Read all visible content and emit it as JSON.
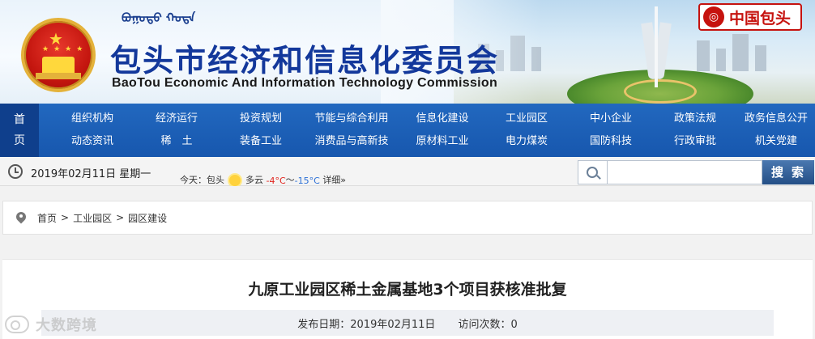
{
  "header": {
    "mongolian_text": "ᠪᠤᠭᠤᠲᠤ ᠬᠣᠲᠠ",
    "title_cn": "包头市经济和信息化委员会",
    "title_en": "BaoTou Economic And Information Technology Commission",
    "china_baotou_label": "中国包头",
    "emblem_star": "★"
  },
  "nav": {
    "home_top": "首",
    "home_bottom": "页",
    "columns": [
      {
        "top": "组织机构",
        "bottom": "动态资讯"
      },
      {
        "top": "经济运行",
        "bottom": "稀　土"
      },
      {
        "top": "投资规划",
        "bottom": "装备工业"
      },
      {
        "top": "节能与综合利用",
        "bottom": "消费品与高新技"
      },
      {
        "top": "信息化建设",
        "bottom": "原材料工业"
      },
      {
        "top": "工业园区",
        "bottom": "电力煤炭"
      },
      {
        "top": "中小企业",
        "bottom": "国防科技"
      },
      {
        "top": "政策法规",
        "bottom": "行政审批"
      },
      {
        "top": "政务信息公开",
        "bottom": "机关党建"
      }
    ]
  },
  "infobar": {
    "date": "2019年02月11日 星期一",
    "weather_label": "今天：包头",
    "weather_desc": "多云",
    "temp_high": "-4°C",
    "temp_sep": "～",
    "temp_low": "-15°C",
    "weather_detail": "详细»"
  },
  "search": {
    "placeholder": "",
    "button_label": "搜索",
    "icon": "search-icon"
  },
  "breadcrumb": {
    "items": [
      "首页",
      "工业园区",
      "园区建设"
    ],
    "separator": ">"
  },
  "article": {
    "title": "九原工业园区稀土金属基地3个项目获核准批复",
    "publish_label": "发布日期：2019年02月11日",
    "visits_label": "访问次数：0"
  },
  "watermark": {
    "text": "大数跨境"
  },
  "colors": {
    "nav_blue": "#1a5fb4",
    "home_dark_blue": "#0f3f8c",
    "title_blue": "#13389b",
    "brand_red": "#c6120e"
  }
}
